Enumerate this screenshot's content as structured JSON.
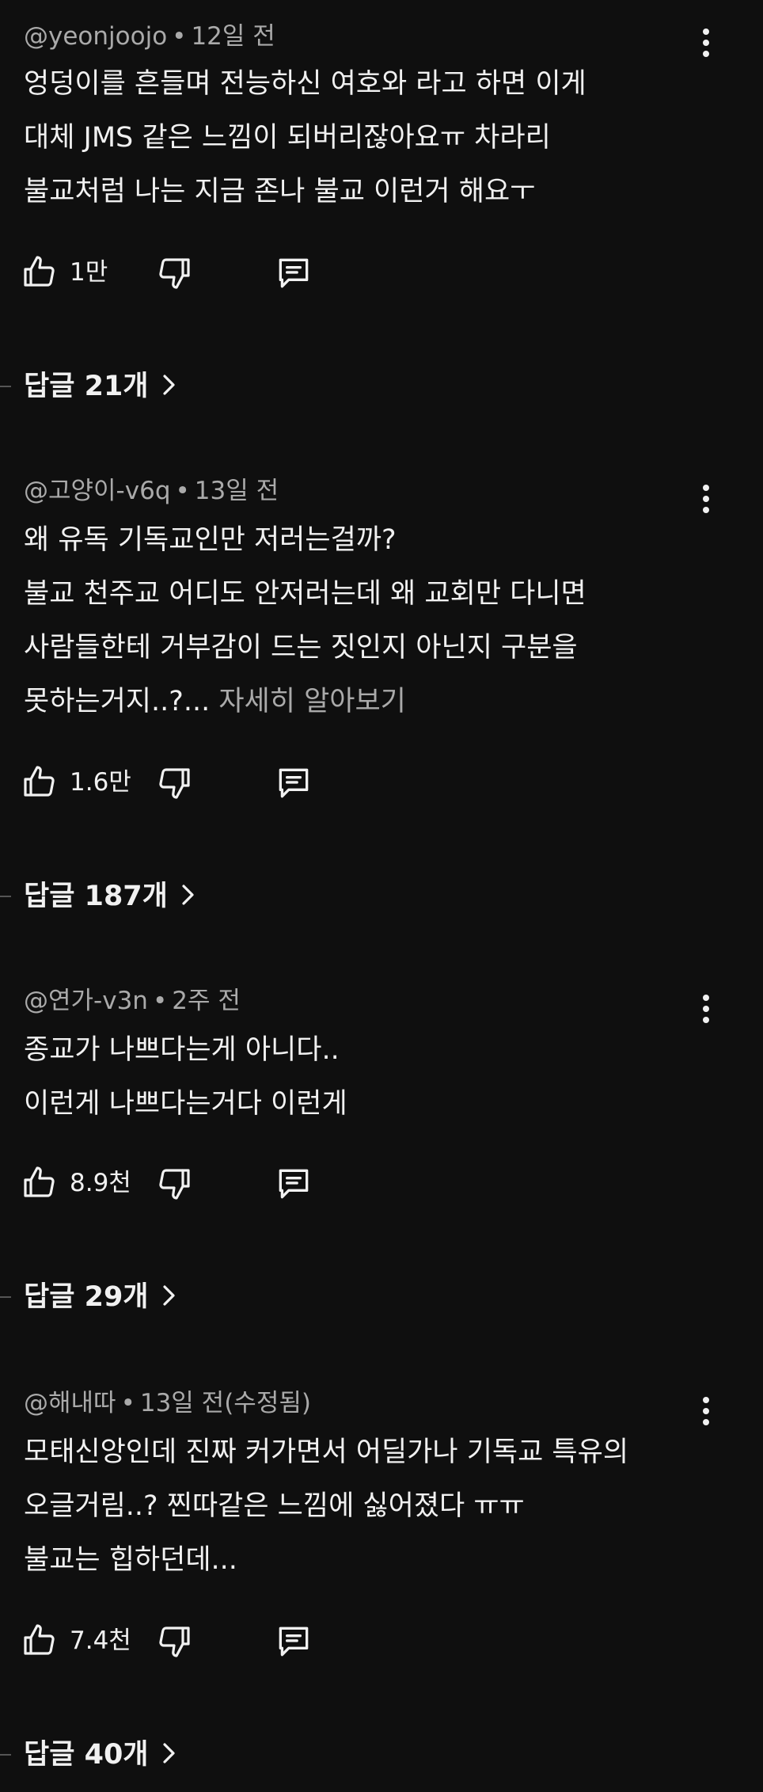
{
  "comments": [
    {
      "author": "@yeonjoojo",
      "time": "12일 전",
      "lines": [
        "엉덩이를 흔들며 전능하신 여호와 라고 하면 이게",
        "대체 JMS 같은 느낌이 되버리잖아요ㅠ 차라리",
        "불교처럼 나는 지금 존나 불교 이런거 해요ㅜ"
      ],
      "see_more": "",
      "likes": "1만",
      "replies": "답글 21개"
    },
    {
      "author": "@고양이-v6q",
      "time": "13일 전",
      "lines": [
        "왜 유독 기독교인만 저러는걸까?",
        "불교 천주교 어디도 안저러는데 왜 교회만 다니면",
        "사람들한테 거부감이 드는 짓인지 아닌지 구분을",
        "못하는거지..?..."
      ],
      "see_more": "자세히 알아보기",
      "likes": "1.6만",
      "replies": "답글 187개"
    },
    {
      "author": "@연가-v3n",
      "time": "2주 전",
      "lines": [
        "종교가 나쁘다는게 아니다..",
        "이런게 나쁘다는거다 이런게"
      ],
      "see_more": "",
      "likes": "8.9천",
      "replies": "답글 29개"
    },
    {
      "author": "@해내따",
      "time": "13일 전(수정됨)",
      "lines": [
        "모태신앙인데 진짜 커가면서 어딜가나 기독교 특유의",
        "오글거림..? 찐따같은 느낌에 싫어졌다 ㅠㅠ",
        "불교는 힙하던데..."
      ],
      "see_more": "",
      "likes": "7.4천",
      "replies": "답글 40개"
    }
  ],
  "icons": {
    "like": "thumbs-up-icon",
    "dislike": "thumbs-down-icon",
    "reply": "comment-icon",
    "more": "more-vert-icon",
    "chevron": "chevron-right-icon"
  },
  "colors": {
    "background": "#0f0f0f",
    "text": "#f1f1f1",
    "secondary_text": "#aaaaaa"
  }
}
